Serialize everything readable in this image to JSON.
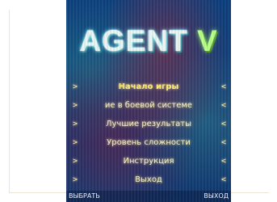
{
  "game": {
    "title_main": "AGENT",
    "title_accent": "V"
  },
  "menu": {
    "items": [
      {
        "label": "Начало игры",
        "arrow_left": ">",
        "arrow_right": "<"
      },
      {
        "label": "ие в боевой системе",
        "arrow_left": ">",
        "arrow_right": "<"
      },
      {
        "label": "Лучшие результаты",
        "arrow_left": ">",
        "arrow_right": "<"
      },
      {
        "label": "Уровень сложности",
        "arrow_left": ">",
        "arrow_right": "<"
      },
      {
        "label": "Инструкция",
        "arrow_left": ">",
        "arrow_right": "<"
      },
      {
        "label": "Выход",
        "arrow_left": ">",
        "arrow_right": "<"
      }
    ]
  },
  "softkeys": {
    "left": "ВЫБРАТЬ",
    "right": "ВЫХОД"
  }
}
